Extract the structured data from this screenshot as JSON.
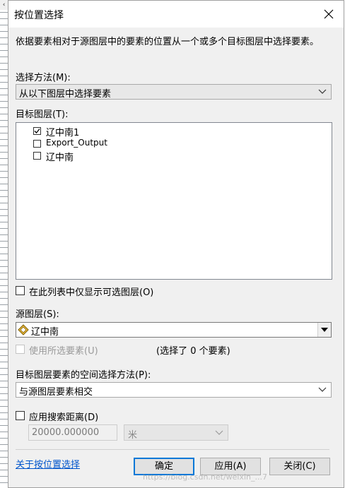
{
  "dialog": {
    "title": "按位置选择",
    "description": "依据要素相对于源图层中的要素的位置从一个或多个目标图层中选择要素。"
  },
  "selection_method": {
    "label": "选择方法(M):",
    "value": "从以下图层中选择要素"
  },
  "target_layers": {
    "label": "目标图层(T):",
    "items": [
      {
        "label": "辽中南1",
        "checked": true
      },
      {
        "label": "Export_Output",
        "checked": false
      },
      {
        "label": "辽中南",
        "checked": false
      }
    ]
  },
  "only_selectable": {
    "label": "在此列表中仅显示可选图层(O)",
    "checked": false
  },
  "source_layer": {
    "label": "源图层(S):",
    "value": "辽中南",
    "icon": "layer-diamond-icon"
  },
  "use_selected": {
    "label": "使用所选要素(U)",
    "checked": false,
    "enabled": false,
    "count_text": "(选择了 0 个要素)"
  },
  "spatial_method": {
    "label": "目标图层要素的空间选择方法(P):",
    "value": "与源图层要素相交"
  },
  "search_distance": {
    "label": "应用搜索距离(D)",
    "checked": false,
    "value": "20000.000000",
    "unit": "米"
  },
  "footer": {
    "help_link": "关于按位置选择",
    "ok_label": "确定",
    "apply_label": "应用(A)",
    "close_label": "关闭(C)"
  },
  "watermark": "https://blog.csdn.net/weixin_...7",
  "colors": {
    "dialog_bg": "#f0f0f0",
    "link": "#0055cc",
    "default_button_border": "#0078d7"
  }
}
